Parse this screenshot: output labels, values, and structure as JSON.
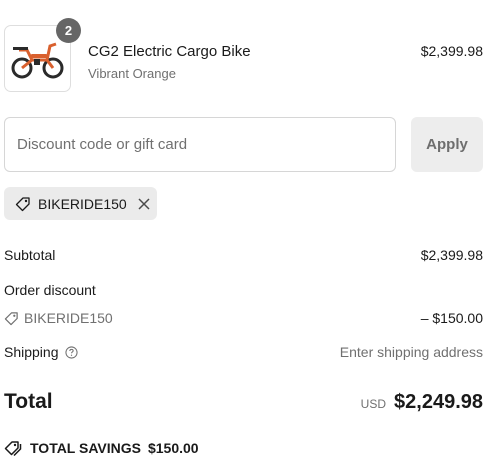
{
  "cart": {
    "item": {
      "quantity": "2",
      "name": "CG2 Electric Cargo Bike",
      "variant": "Vibrant Orange",
      "price": "$2,399.98",
      "image_icon": "orange-cargo-bike-image"
    }
  },
  "discount": {
    "placeholder": "Discount code or gift card",
    "value": "",
    "apply_label": "Apply",
    "applied_code": "BIKERIDE150"
  },
  "summary": {
    "subtotal_label": "Subtotal",
    "subtotal_value": "$2,399.98",
    "order_discount_label": "Order discount",
    "discount_code": "BIKERIDE150",
    "discount_value": "– $150.00",
    "shipping_label": "Shipping",
    "shipping_value": "Enter shipping address",
    "total_label": "Total",
    "currency": "USD",
    "total_value": "$2,249.98",
    "savings_label": "TOTAL SAVINGS",
    "savings_value": "$150.00"
  },
  "colors": {
    "bike_orange": "#d9602e",
    "badge_gray": "#666666",
    "muted_text": "#707070"
  }
}
